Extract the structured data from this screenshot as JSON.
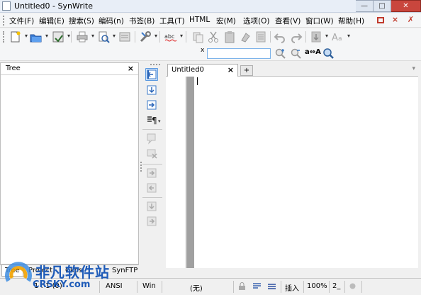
{
  "window": {
    "title": "Untitled0 - SynWrite"
  },
  "menu": [
    "文件(F)",
    "编辑(E)",
    "搜索(S)",
    "编码(n)",
    "书签(B)",
    "工具(T)",
    "HTML",
    "宏(M)",
    "选项(O)",
    "查看(V)",
    "窗口(W)",
    "帮助(H)"
  ],
  "toolbar2": {
    "search_label": "x",
    "search_value": "",
    "case_label": "a⇔A"
  },
  "tree_panel": {
    "title": "Tree",
    "close": "×"
  },
  "tabs": {
    "doc_label": "Untitled0",
    "close": "×",
    "new": "+"
  },
  "bottom_tabs": [
    "Tree",
    "Project",
    "Clips",
    "SynFTP"
  ],
  "status": {
    "pos": "1 : 1 (0)",
    "encoding": "ANSI",
    "lineend": "Win",
    "lexer": "(无)",
    "mode": "插入",
    "zoom": "100%",
    "tab": "2_"
  },
  "watermark": {
    "cn": "非凡软件站",
    "en": "CRSKY.com"
  }
}
